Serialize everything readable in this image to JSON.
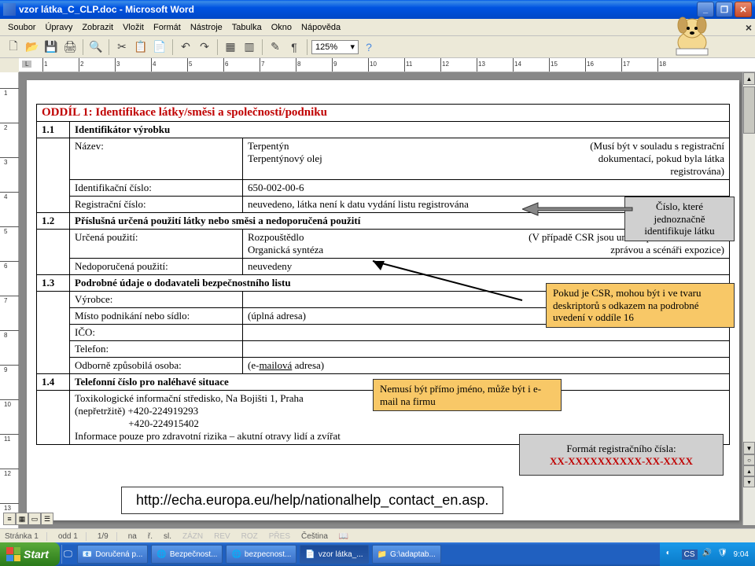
{
  "window": {
    "title": "vzor látka_C_CLP.doc - Microsoft Word"
  },
  "menu": {
    "items": [
      "Soubor",
      "Úpravy",
      "Zobrazit",
      "Vložit",
      "Formát",
      "Nástroje",
      "Tabulka",
      "Okno",
      "Nápověda"
    ],
    "close_doc": "×"
  },
  "toolbar": {
    "zoom": "125%"
  },
  "document": {
    "section_header": "ODDÍL 1:  Identifikace látky/směsi a společnosti/podniku",
    "r11_num": "1.1",
    "r11_label": "Identifikátor výrobku",
    "r_name_label": "Název:",
    "r_name_val1": "Terpentýn",
    "r_name_val2": "Terpentýnový olej",
    "r_name_note": "(Musí být v souladu s registrační dokumentací, pokud byla látka registrována)",
    "r_id_label": "Identifikační číslo:",
    "r_id_val": "650-002-00-6",
    "r_reg_label": "Registrační číslo:",
    "r_reg_val": "neuvedeno, látka není k datu vydání listu registrována",
    "r12_num": "1.2",
    "r12_label": "Příslušná určená použití látky nebo směsi a nedoporučená použití",
    "r_use_label": "Určená použití:",
    "r_use_val1": "Rozpouštědlo",
    "r_use_val2": "Organická syntéza",
    "r_use_note": "(V případě CSR jsou určená použití ve shodě se zprávou a scénáři expozice)",
    "r_nuse_label": "Nedoporučená použití:",
    "r_nuse_val": "neuvedeny",
    "r13_num": "1.3",
    "r13_label": "Podrobné údaje o dodavateli bezpečnostního listu",
    "r_vyrob_label": "Výrobce:",
    "r_misto_label": "Místo podnikání nebo sídlo:",
    "r_misto_val": "(úplná adresa)",
    "r_ico_label": "IČO:",
    "r_tel_label": "Telefon:",
    "r_osoba_label": "Odborně způsobilá osoba:",
    "r_osoba_val": "(e-mailová adresa)",
    "r14_num": "1.4",
    "r14_label": "Telefonní číslo pro naléhavé situace",
    "r14_body1": "Toxikologické informační středisko, Na Bojišti 1, Praha",
    "r14_body2": "(nepřetržitě)   +420-224919293",
    "r14_body3": "                     +420-224915402",
    "r14_body4": "Informace pouze pro zdravotní rizika – akutní otravy lidí a zvířat"
  },
  "callouts": {
    "c1": "Číslo, které jednoznačně identifikuje látku",
    "c2": "Pokud je CSR,  mohou být i ve tvaru deskriptorů s odkazem na podrobné uvedení v oddíle 16",
    "c3": "Nemusí být přímo jméno, může být i e-mail na firmu",
    "c4a": "Formát registračního čísla:",
    "c4b": "XX-XXXXXXXXXX-XX-XXXX",
    "url": "http://echa.europa.eu/help/nationalhelp_contact_en.asp."
  },
  "status": {
    "page": "Stránka 1",
    "sec": "odd 1",
    "pages": "1/9",
    "at": "na",
    "ln": "ř.",
    "col": "sl.",
    "modes": [
      "ZÁZN",
      "REV",
      "ROZ",
      "PŘES"
    ],
    "lang": "Čeština"
  },
  "taskbar": {
    "start": "Start",
    "buttons": [
      "Doručená p...",
      "Bezpečnost...",
      "bezpecnost...",
      "vzor látka_...",
      "G:\\adaptab..."
    ],
    "lang": "CS",
    "time": "9:04"
  },
  "ruler_h": [
    1,
    2,
    3,
    4,
    5,
    6,
    7,
    8,
    9,
    10,
    11,
    12,
    13,
    14,
    15,
    16,
    17,
    18
  ],
  "ruler_v": [
    1,
    2,
    3,
    4,
    5,
    6,
    7,
    8,
    9,
    10,
    11,
    12,
    13
  ]
}
